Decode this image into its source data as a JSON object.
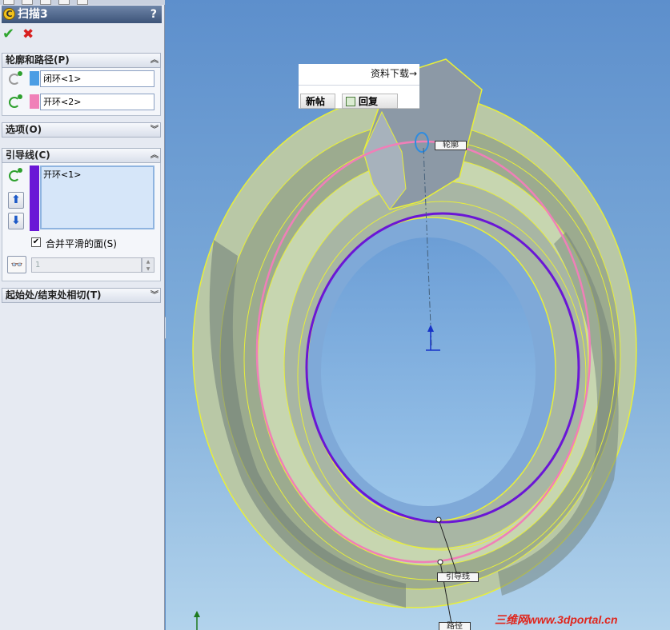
{
  "panel": {
    "title": "扫描3",
    "help": "?",
    "ok_symbol": "✔",
    "cancel_symbol": "✖",
    "profile_path": {
      "header": "轮廓和路径(P)",
      "profile_value": "闭环<1>",
      "path_value": "开环<2>",
      "profile_color": "#4b9de4",
      "path_color": "#f080b8"
    },
    "options": {
      "header": "选项(O)"
    },
    "guide_curves": {
      "header": "引导线(C)",
      "items": [
        "开环<1>"
      ],
      "swatch_color": "#6a16d6",
      "up_symbol": "⬆",
      "down_symbol": "⬇",
      "merge_label": "合并平滑的面(S)",
      "merge_checked": true,
      "spin_value": "1"
    },
    "tangency": {
      "header": "起始处/结束处相切(T)"
    }
  },
  "viewport": {
    "forum_overlay": {
      "link": "资料下载→",
      "new_post": "新帖",
      "reply": "回复"
    },
    "callouts": {
      "profile": "轮廓",
      "guide": "引导线",
      "path": "路径"
    },
    "watermark": "三维网www.3dportal.cn"
  }
}
